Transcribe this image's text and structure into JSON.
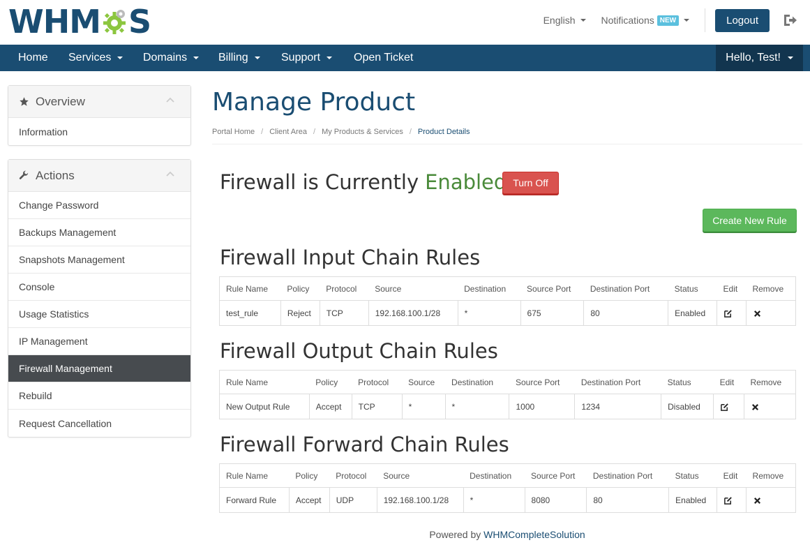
{
  "header": {
    "logo_left": "WHM",
    "logo_right": "S",
    "language": "English",
    "notifications": "Notifications",
    "notifications_badge": "NEW",
    "logout": "Logout"
  },
  "nav": {
    "items": [
      "Home",
      "Services",
      "Domains",
      "Billing",
      "Support",
      "Open Ticket"
    ],
    "user": "Hello, Test!"
  },
  "sidebar": {
    "overview": {
      "title": "Overview",
      "items": [
        "Information"
      ]
    },
    "actions": {
      "title": "Actions",
      "items": [
        "Change Password",
        "Backups Management",
        "Snapshots Management",
        "Console",
        "Usage Statistics",
        "IP Management",
        "Firewall Management",
        "Rebuild",
        "Request Cancellation"
      ],
      "active": "Firewall Management"
    }
  },
  "main": {
    "title": "Manage Product",
    "breadcrumb": [
      "Portal Home",
      "Client Area",
      "My Products & Services",
      "Product Details"
    ],
    "firewall_status_prefix": "Firewall is Currently",
    "firewall_status_value": "Enabled",
    "turn_off": "Turn Off",
    "create_rule": "Create New Rule",
    "tables": [
      {
        "title": "Firewall Input Chain Rules",
        "headers": [
          "Rule Name",
          "Policy",
          "Protocol",
          "Source",
          "Destination",
          "Source Port",
          "Destination Port",
          "Status",
          "Edit",
          "Remove"
        ],
        "rows": [
          [
            "test_rule",
            "Reject",
            "TCP",
            "192.168.100.1/28",
            "*",
            "675",
            "80",
            "Enabled"
          ]
        ]
      },
      {
        "title": "Firewall Output Chain Rules",
        "headers": [
          "Rule Name",
          "Policy",
          "Protocol",
          "Source",
          "Destination",
          "Source Port",
          "Destination Port",
          "Status",
          "Edit",
          "Remove"
        ],
        "rows": [
          [
            "New Output Rule",
            "Accept",
            "TCP",
            "*",
            "*",
            "1000",
            "1234",
            "Disabled"
          ]
        ]
      },
      {
        "title": "Firewall Forward Chain Rules",
        "headers": [
          "Rule Name",
          "Policy",
          "Protocol",
          "Source",
          "Destination",
          "Source Port",
          "Destination Port",
          "Status",
          "Edit",
          "Remove"
        ],
        "rows": [
          [
            "Forward Rule",
            "Accept",
            "UDP",
            "192.168.100.1/28",
            "*",
            "8080",
            "80",
            "Enabled"
          ]
        ]
      }
    ]
  },
  "footer": {
    "prefix": "Powered by",
    "link": "WHMCompleteSolution"
  },
  "colors": {
    "brand": "#1a4d72",
    "danger": "#d9534f",
    "success": "#5cb85c",
    "enabled_text": "#4a8a3a",
    "badge": "#5bc0de"
  }
}
